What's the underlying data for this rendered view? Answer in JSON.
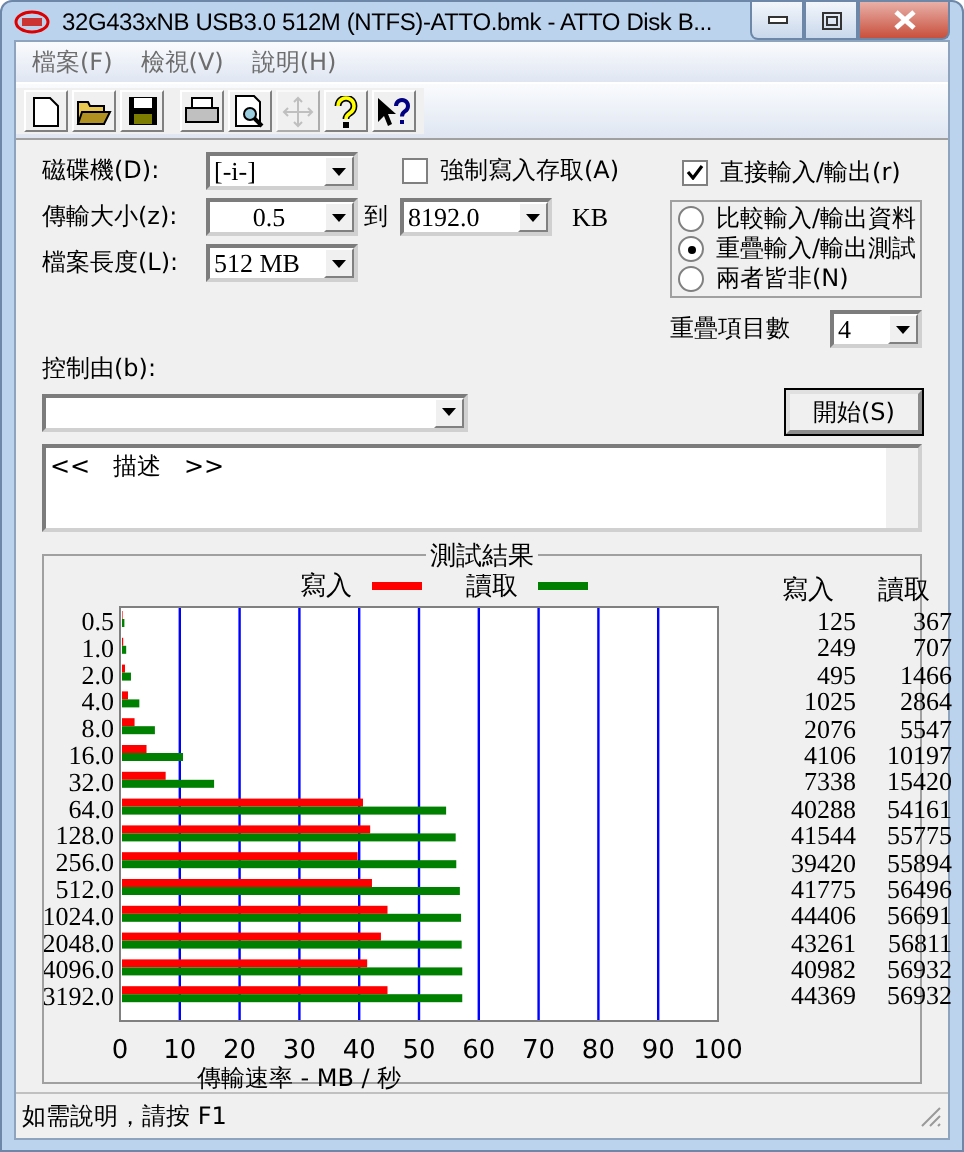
{
  "window": {
    "title": "32G433xNB USB3.0 512M (NTFS)-ATTO.bmk - ATTO Disk B..."
  },
  "menu": [
    "檔案(F)",
    "檢視(V)",
    "說明(H)"
  ],
  "toolbar": [
    {
      "kind": "new",
      "disabled": false
    },
    {
      "kind": "open",
      "disabled": false
    },
    {
      "kind": "save",
      "disabled": false
    },
    {
      "kind": "print",
      "disabled": false
    },
    {
      "kind": "preview",
      "disabled": false
    },
    {
      "kind": "move",
      "disabled": true
    },
    {
      "kind": "help",
      "disabled": false
    },
    {
      "kind": "context-help",
      "disabled": false
    }
  ],
  "form": {
    "drive": {
      "label": "磁碟機(D):",
      "value": "[-i-]"
    },
    "transfer": {
      "label": "傳輸大小(z):",
      "from": "0.5",
      "to_label": "到",
      "to": "8192.0",
      "unit": "KB"
    },
    "file_length": {
      "label": "檔案長度(L):",
      "value": "512 MB"
    },
    "force_write": {
      "label": "強制寫入存取(A)",
      "checked": false
    },
    "direct_io": {
      "label": "直接輸入/輸出(r)",
      "checked": true
    },
    "io_modes": [
      {
        "label": "比較輸入/輸出資料",
        "selected": false
      },
      {
        "label": "重疊輸入/輸出測試",
        "selected": true
      },
      {
        "label": "兩者皆非(N)",
        "selected": false
      }
    ],
    "queue_depth": {
      "label": "重疊項目數",
      "value": "4"
    },
    "controlled_by": {
      "label": "控制由(b):"
    },
    "start_button": "開始(S)",
    "description": "<<   描述   >>"
  },
  "results": {
    "title": "測試結果",
    "columns": [
      "寫入",
      "讀取"
    ],
    "rows": [
      {
        "write": "125",
        "read": "367"
      },
      {
        "write": "249",
        "read": "707"
      },
      {
        "write": "495",
        "read": "1466"
      },
      {
        "write": "1025",
        "read": "2864"
      },
      {
        "write": "2076",
        "read": "5547"
      },
      {
        "write": "4106",
        "read": "10197"
      },
      {
        "write": "7338",
        "read": "15420"
      },
      {
        "write": "40288",
        "read": "54161"
      },
      {
        "write": "41544",
        "read": "55775"
      },
      {
        "write": "39420",
        "read": "55894"
      },
      {
        "write": "41775",
        "read": "56496"
      },
      {
        "write": "44406",
        "read": "56691"
      },
      {
        "write": "43261",
        "read": "56811"
      },
      {
        "write": "40982",
        "read": "56932"
      },
      {
        "write": "44369",
        "read": "56932"
      }
    ],
    "chart_data": {
      "type": "bar",
      "orientation": "horizontal",
      "xlabel": "傳輸速率 - MB / 秒",
      "categories": [
        "0.5",
        "1.0",
        "2.0",
        "4.0",
        "8.0",
        "16.0",
        "32.0",
        "64.0",
        "128.0",
        "256.0",
        "512.0",
        "1024.0",
        "2048.0",
        "4096.0",
        "3192.0"
      ],
      "series": [
        {
          "name": "寫入",
          "color": "#ff0000",
          "values": [
            0.1,
            0.2,
            0.5,
            1.0,
            2.1,
            4.1,
            7.3,
            40.3,
            41.5,
            39.4,
            41.8,
            44.4,
            43.3,
            41.0,
            44.4
          ]
        },
        {
          "name": "讀取",
          "color": "#008000",
          "values": [
            0.4,
            0.7,
            1.5,
            2.9,
            5.5,
            10.2,
            15.4,
            54.2,
            55.8,
            55.9,
            56.5,
            56.7,
            56.8,
            56.9,
            56.9
          ]
        }
      ],
      "grid": true,
      "xlim": [
        0,
        100
      ],
      "xticks": [
        0,
        10,
        20,
        30,
        40,
        50,
        60,
        70,
        80,
        90,
        100
      ]
    }
  },
  "status_bar": "如需說明，請按 F1"
}
